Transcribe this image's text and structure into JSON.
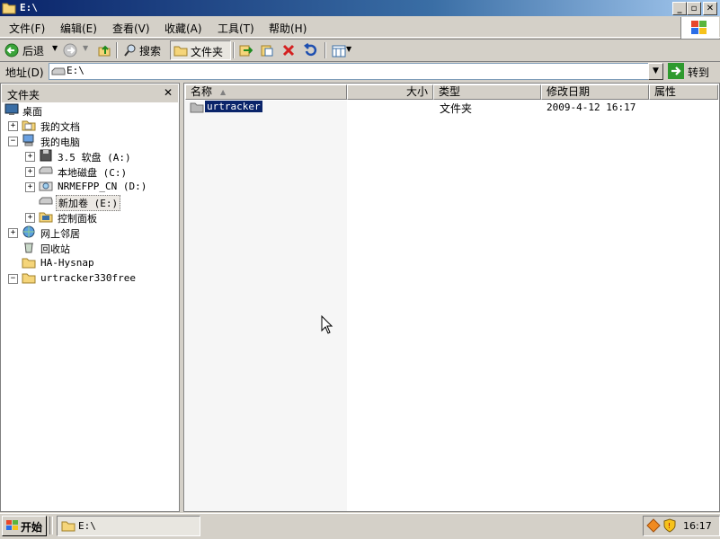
{
  "window": {
    "title": "E:\\"
  },
  "menu": [
    {
      "label": "文件(F)"
    },
    {
      "label": "编辑(E)"
    },
    {
      "label": "查看(V)"
    },
    {
      "label": "收藏(A)"
    },
    {
      "label": "工具(T)"
    },
    {
      "label": "帮助(H)"
    }
  ],
  "toolbar": {
    "back_label": "后退",
    "search_label": "搜索",
    "folders_label": "文件夹"
  },
  "address": {
    "label": "地址(D)",
    "value": "E:\\",
    "go_label": "转到"
  },
  "folders_pane": {
    "title": "文件夹",
    "tree": [
      {
        "label": "桌面"
      },
      {
        "label": "我的文档"
      },
      {
        "label": "我的电脑"
      },
      {
        "label": "3.5 软盘 (A:)"
      },
      {
        "label": "本地磁盘 (C:)"
      },
      {
        "label": "NRMEFPP_CN (D:)"
      },
      {
        "label": "新加卷 (E:)"
      },
      {
        "label": "控制面板"
      },
      {
        "label": "网上邻居"
      },
      {
        "label": "回收站"
      },
      {
        "label": "HA-Hysnap"
      },
      {
        "label": "urtracker330free"
      }
    ]
  },
  "file_list": {
    "columns": [
      "名称",
      "大小",
      "类型",
      "修改日期",
      "属性"
    ],
    "rows": [
      {
        "name": "urtracker",
        "size": "",
        "type": "文件夹",
        "modified": "2009-4-12 16:17",
        "attributes": ""
      }
    ]
  },
  "taskbar": {
    "start_label": "开始",
    "task_label": "E:\\",
    "clock": "16:17"
  },
  "colors": {
    "title_start": "#0a246a",
    "title_end": "#a6caf0",
    "face": "#d4d0c8",
    "selection": "#0a246a"
  }
}
